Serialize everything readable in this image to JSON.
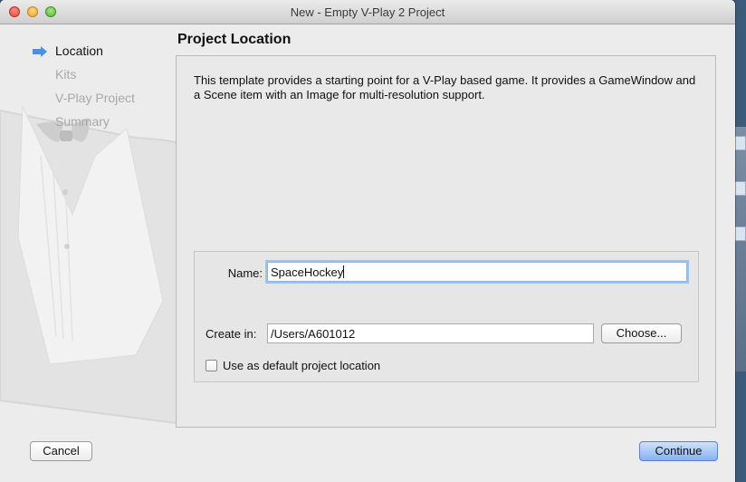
{
  "window": {
    "title": "New - Empty V-Play 2 Project"
  },
  "sidebar": {
    "steps": [
      {
        "label": "Location",
        "current": true
      },
      {
        "label": "Kits",
        "current": false
      },
      {
        "label": "V-Play Project",
        "current": false
      },
      {
        "label": "Summary",
        "current": false
      }
    ]
  },
  "main": {
    "heading": "Project Location",
    "description": "This template provides a starting point for a V-Play based game. It provides a GameWindow and a Scene item with an Image for multi-resolution support.",
    "name_label": "Name:",
    "name_value": "SpaceHockey",
    "create_in_label": "Create in:",
    "create_in_value": "/Users/A601012",
    "choose_button": "Choose...",
    "default_location_label": "Use as default project location",
    "default_location_checked": false
  },
  "footer": {
    "cancel_label": "Cancel",
    "continue_label": "Continue"
  },
  "colors": {
    "accent": "#85b2f0",
    "focus_ring": "#9cc3f0"
  }
}
